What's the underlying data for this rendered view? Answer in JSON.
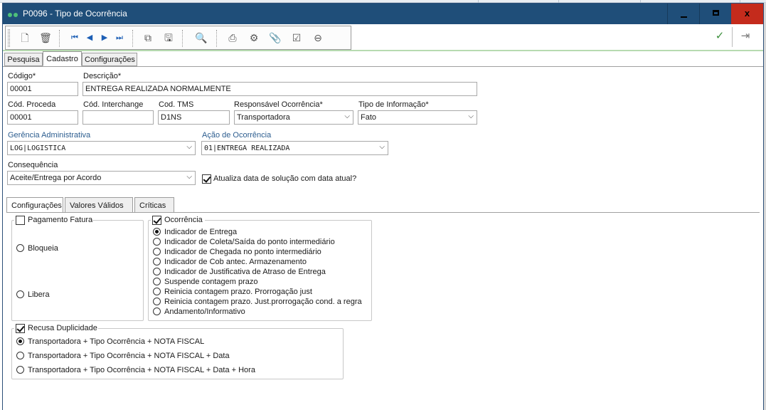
{
  "window": {
    "title": "P0096 - Tipo de Ocorrência",
    "minimize_icon": "minimize-icon",
    "maximize_icon": "maximize-icon",
    "close_glyph": "x"
  },
  "colors": {
    "titlebar": "#1f4e79",
    "close_button": "#c42b1c",
    "label_blue": "#2c5d8f",
    "nav_blue": "#1d5fb5",
    "confirm_green": "#3b8f3b"
  },
  "toolbar": {
    "icons": [
      "new-document-icon",
      "delete-icon",
      "first-record-icon",
      "previous-record-icon",
      "next-record-icon",
      "last-record-icon",
      "copy-icon",
      "save-icon",
      "search-icon",
      "print-icon",
      "settings-icon",
      "attach-icon",
      "checkbox-icon",
      "link-icon",
      "confirm-icon",
      "exit-icon"
    ],
    "glyphs": {
      "new": "🗋",
      "delete": "🗑",
      "first": "⏮",
      "prev": "◀",
      "next": "▶",
      "last": "⏭",
      "copy": "⧉",
      "save": "🖫",
      "search": "🔍",
      "print": "⎙",
      "settings": "⚙",
      "attach": "📎",
      "check": "☑",
      "link": "⊖",
      "confirm": "✓",
      "exit": "⇥"
    }
  },
  "tabs": [
    "Pesquisa",
    "Cadastro",
    "Configurações"
  ],
  "form": {
    "codigo": {
      "label": "Código*",
      "value": "00001"
    },
    "descricao": {
      "label": "Descrição*",
      "value": "ENTREGA REALIZADA NORMALMENTE"
    },
    "cod_proceda": {
      "label": "Cód. Proceda",
      "value": "00001"
    },
    "cod_interchange": {
      "label": "Cód. Interchange",
      "value": ""
    },
    "cod_tms": {
      "label": "Cod. TMS",
      "value": "D1NS"
    },
    "responsavel": {
      "label": "Responsável Ocorrência*",
      "value": "Transportadora"
    },
    "tipo_informacao": {
      "label": "Tipo de Informação*",
      "value": "Fato"
    },
    "gerencia": {
      "label": "Gerência Administrativa",
      "value": "LOG|LOGISTICA"
    },
    "acao": {
      "label": "Ação de Ocorrência",
      "value": "01|ENTREGA REALIZADA"
    },
    "consequencia": {
      "label": "Consequência",
      "value": "Aceite/Entrega por Acordo"
    },
    "atualiza_data": {
      "label": "Atualiza data de solução com data atual?",
      "checked": true
    }
  },
  "inner_tabs": [
    "Configurações",
    "Valores Válidos",
    "Críticas"
  ],
  "pagamento": {
    "title": "Pagamento Fatura",
    "checked": false,
    "options": [
      {
        "label": "Bloqueia",
        "selected": false
      },
      {
        "label": "Libera",
        "selected": false
      }
    ]
  },
  "ocorrencia": {
    "title": "Ocorrência",
    "checked": true,
    "options": [
      {
        "label": "Indicador de Entrega",
        "selected": true
      },
      {
        "label": "Indicador de Coleta/Saída do ponto intermediário",
        "selected": false
      },
      {
        "label": "Indicador de Chegada no ponto intermediário",
        "selected": false
      },
      {
        "label": "Indicador de Cob antec. Armazenamento",
        "selected": false
      },
      {
        "label": "Indicador de Justificativa de Atraso de Entrega",
        "selected": false
      },
      {
        "label": "Suspende contagem prazo",
        "selected": false
      },
      {
        "label": "Reinicia contagem prazo. Prorrogação just",
        "selected": false
      },
      {
        "label": "Reinicia contagem prazo. Just.prorrogação cond. a regra",
        "selected": false
      },
      {
        "label": "Andamento/Informativo",
        "selected": false
      }
    ]
  },
  "duplicidade": {
    "title": "Recusa Duplicidade",
    "checked": true,
    "options": [
      {
        "label": "Transportadora + Tipo Ocorrência + NOTA FISCAL",
        "selected": true
      },
      {
        "label": "Transportadora + Tipo Ocorrência + NOTA FISCAL + Data",
        "selected": false
      },
      {
        "label": "Transportadora + Tipo Ocorrência + NOTA FISCAL + Data + Hora",
        "selected": false
      }
    ]
  }
}
